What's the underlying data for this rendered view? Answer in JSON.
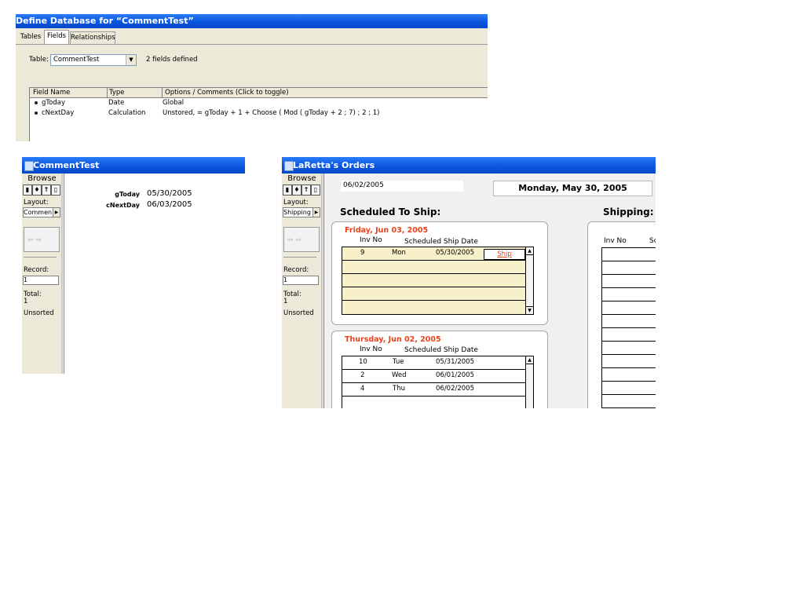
{
  "define_db": {
    "title": "Define Database for “CommentTest”",
    "tabs": [
      "Tables",
      "Fields",
      "Relationships"
    ],
    "table_label": "Table:",
    "table_value": "CommentTest",
    "fields_count": "2 fields defined",
    "columns": [
      "Field Name",
      "Type",
      "Options / Comments   (Click to toggle)"
    ],
    "fields": [
      {
        "name": "gToday",
        "type": "Date",
        "options": "Global"
      },
      {
        "name": "cNextDay",
        "type": "Calculation",
        "options": "Unstored, = gToday + 1  +  Choose ( Mod ( gToday + 2 ; 7) ; 2 ; 1)"
      }
    ]
  },
  "comment_win": {
    "title": "CommentTest",
    "mode": "Browse",
    "layout_label": "Layout:",
    "layout_value": "Commen",
    "record_label": "Record:",
    "record_value": "1",
    "total_label": "Total:",
    "total_value": "1",
    "sort_status": "Unsorted",
    "fields": [
      {
        "label": "gToday",
        "value": "05/30/2005"
      },
      {
        "label": "cNextDay",
        "value": "06/03/2005"
      }
    ]
  },
  "orders_win": {
    "title": "LaRetta's Orders",
    "mode": "Browse",
    "layout_label": "Layout:",
    "layout_value": "Shipping",
    "record_label": "Record:",
    "record_value": "1",
    "total_label": "Total:",
    "total_value": "1",
    "sort_status": "Unsorted",
    "date_field": "06/02/2005",
    "date_display": "Monday, May 30, 2005",
    "scheduled_heading": "Scheduled To Ship:",
    "shipping_heading": "Shipping:",
    "shipping_col": "Inv No",
    "shipping_col2": "Sc",
    "groups": [
      {
        "date": "Friday, Jun 03, 2005",
        "col_inv": "Inv No",
        "col_date": "Scheduled Ship Date",
        "rows": [
          {
            "inv": "9",
            "day": "Mon",
            "date": "05/30/2005",
            "action": "Ship"
          }
        ]
      },
      {
        "date": "Thursday, Jun 02, 2005",
        "col_inv": "Inv No",
        "col_date": "Scheduled Ship Date",
        "rows": [
          {
            "inv": "10",
            "day": "Tue",
            "date": "05/31/2005"
          },
          {
            "inv": "2",
            "day": "Wed",
            "date": "06/01/2005"
          },
          {
            "inv": "4",
            "day": "Thu",
            "date": "06/02/2005"
          }
        ]
      }
    ],
    "accent_color": "#e8431c",
    "portal_bg": "#f7f0c8"
  }
}
